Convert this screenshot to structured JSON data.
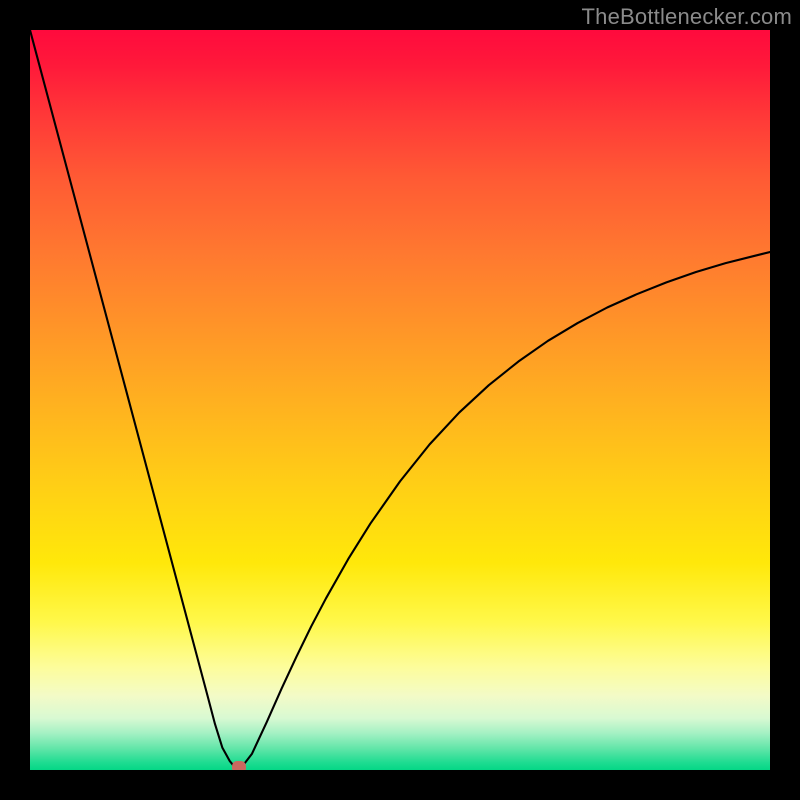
{
  "watermark": "TheBottlenecker.com",
  "chart_data": {
    "type": "line",
    "title": "",
    "xlabel": "",
    "ylabel": "",
    "xlim": [
      0,
      100
    ],
    "ylim": [
      0,
      100
    ],
    "x": [
      0,
      2,
      4,
      6,
      8,
      10,
      12,
      14,
      16,
      18,
      20,
      22,
      24,
      25,
      26,
      27,
      27.5,
      28,
      28.3,
      28.6,
      29,
      30,
      32,
      34,
      36,
      38,
      40,
      43,
      46,
      50,
      54,
      58,
      62,
      66,
      70,
      74,
      78,
      82,
      86,
      90,
      94,
      98,
      100
    ],
    "y": [
      100,
      92.5,
      85,
      77.5,
      70,
      62.5,
      55,
      47.5,
      40,
      32.5,
      25,
      17.5,
      10,
      6.2,
      3,
      1.2,
      0.6,
      0.4,
      0.4,
      0.5,
      0.9,
      2.2,
      6.5,
      11,
      15.3,
      19.4,
      23.2,
      28.5,
      33.3,
      39,
      44,
      48.3,
      52,
      55.2,
      58,
      60.4,
      62.5,
      64.3,
      65.9,
      67.3,
      68.5,
      69.5,
      70
    ],
    "marker": {
      "x": 28.3,
      "y": 0.4
    },
    "gradient_stops": [
      {
        "pos": 0,
        "color": "#ff0a3d"
      },
      {
        "pos": 50,
        "color": "#ffb020"
      },
      {
        "pos": 80,
        "color": "#fff84a"
      },
      {
        "pos": 100,
        "color": "#04d786"
      }
    ]
  }
}
